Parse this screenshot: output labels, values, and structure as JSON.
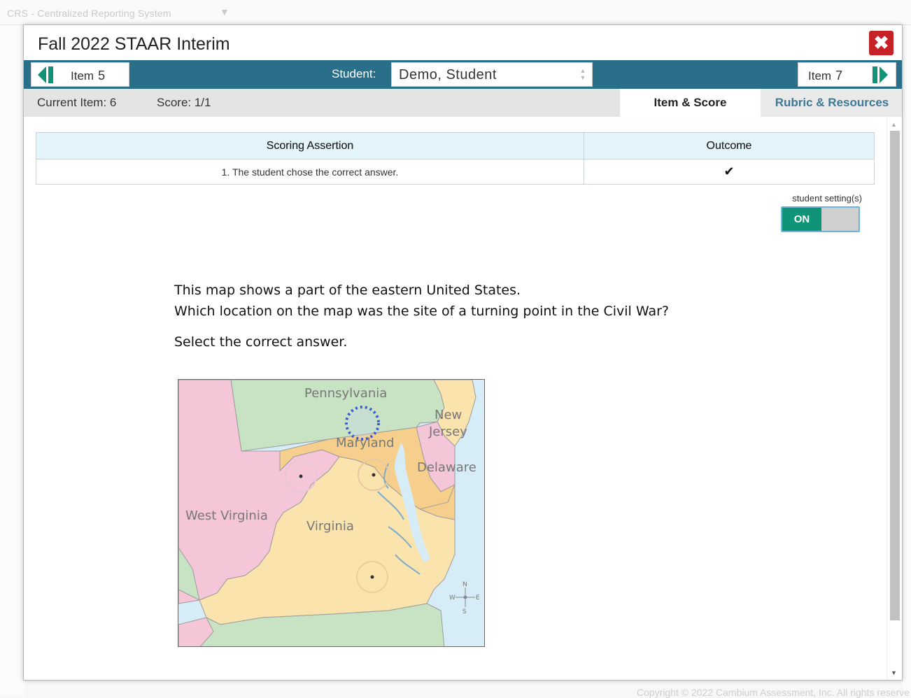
{
  "background": {
    "app_title": "CRS - Centralized Reporting System",
    "footer": "Copyright © 2022 Cambium Assessment, Inc. All rights reserve"
  },
  "modal": {
    "title": "Fall 2022 STAAR Interim",
    "close_icon": "close-x-icon"
  },
  "nav": {
    "prev_label": "Item",
    "prev_number": "5",
    "next_label": "Item",
    "next_number": "7",
    "student_label": "Student:",
    "student_value": "Demo, Student"
  },
  "info": {
    "current_item": "Current Item: 6",
    "score": "Score: 1/1"
  },
  "tabs": [
    {
      "label": "Item & Score",
      "active": true
    },
    {
      "label": "Rubric & Resources",
      "active": false
    }
  ],
  "scoring_table": {
    "headers": [
      "Scoring Assertion",
      "Outcome"
    ],
    "rows": [
      {
        "assertion": "1. The student chose the correct answer.",
        "outcome": "✔"
      }
    ]
  },
  "setting": {
    "label": "student setting(s)",
    "toggle_label": "ON",
    "state": "on"
  },
  "question": {
    "line1": "This map shows a part of the eastern United States.",
    "line2": "Which location on the map was the site of a turning point in the Civil War?",
    "instruction": "Select the correct answer."
  },
  "map": {
    "labels": {
      "pennsylvania": "Pennsylvania",
      "new": "New",
      "jersey": "Jersey",
      "maryland": "Maryland",
      "delaware": "Delaware",
      "west_virginia": "West Virginia",
      "virginia": "Virginia",
      "compass_n": "N",
      "compass_s": "S",
      "compass_e": "E",
      "compass_w": "W"
    },
    "selected_option": "pennsylvania-location",
    "colors": {
      "pennsylvania": "#c7e3c4",
      "maryland": "#f7cf8c",
      "virginia": "#fbe3ae",
      "west_virginia": "#f5c6d7",
      "water": "#d6ecf6",
      "selection": "#3d5bd6"
    }
  },
  "colors": {
    "navbar": "#2a6f89",
    "close_button": "#c62127",
    "toggle_on": "#109477",
    "table_header": "#e3f5fa"
  }
}
